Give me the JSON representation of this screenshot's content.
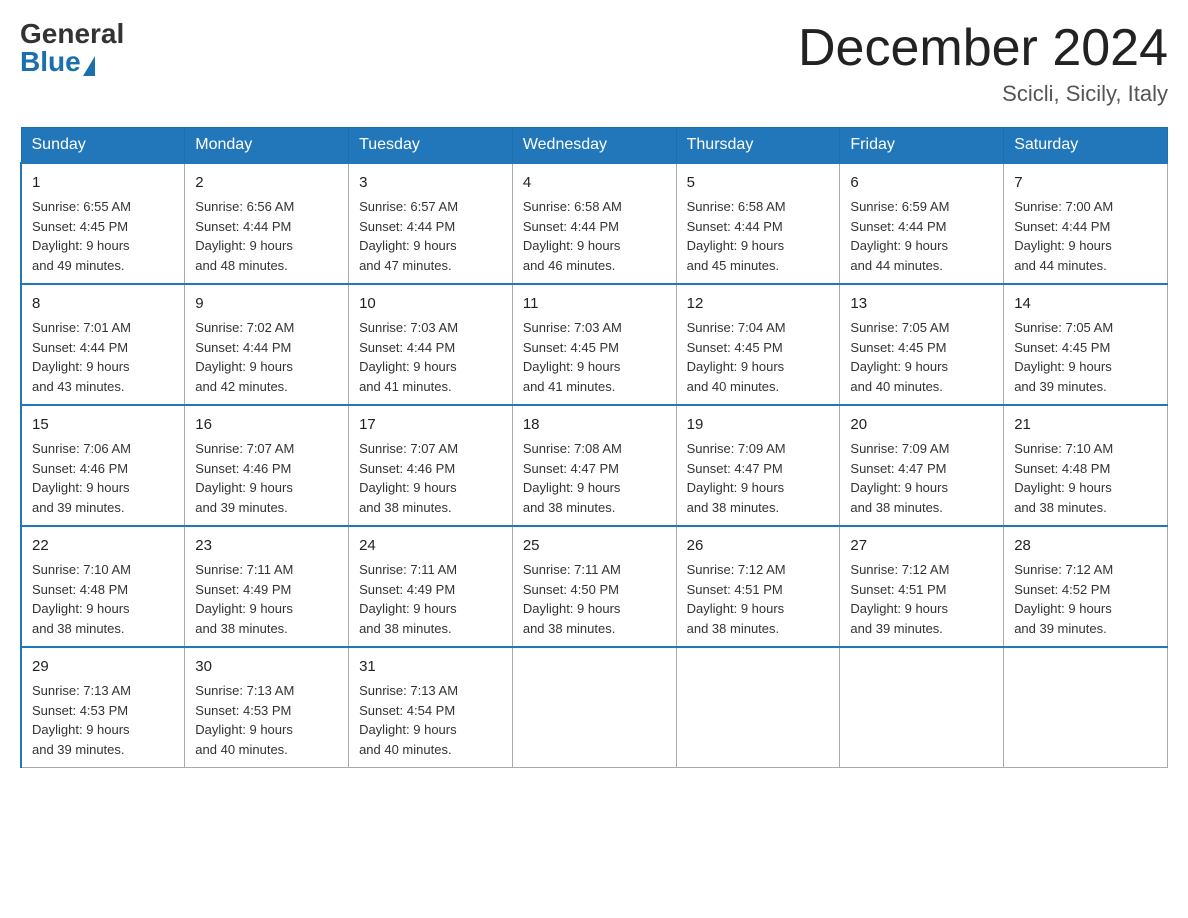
{
  "header": {
    "logo": {
      "general": "General",
      "blue": "Blue"
    },
    "title": "December 2024",
    "location": "Scicli, Sicily, Italy"
  },
  "days_of_week": [
    "Sunday",
    "Monday",
    "Tuesday",
    "Wednesday",
    "Thursday",
    "Friday",
    "Saturday"
  ],
  "weeks": [
    [
      {
        "day": "1",
        "sunrise": "6:55 AM",
        "sunset": "4:45 PM",
        "daylight": "9 hours and 49 minutes."
      },
      {
        "day": "2",
        "sunrise": "6:56 AM",
        "sunset": "4:44 PM",
        "daylight": "9 hours and 48 minutes."
      },
      {
        "day": "3",
        "sunrise": "6:57 AM",
        "sunset": "4:44 PM",
        "daylight": "9 hours and 47 minutes."
      },
      {
        "day": "4",
        "sunrise": "6:58 AM",
        "sunset": "4:44 PM",
        "daylight": "9 hours and 46 minutes."
      },
      {
        "day": "5",
        "sunrise": "6:58 AM",
        "sunset": "4:44 PM",
        "daylight": "9 hours and 45 minutes."
      },
      {
        "day": "6",
        "sunrise": "6:59 AM",
        "sunset": "4:44 PM",
        "daylight": "9 hours and 44 minutes."
      },
      {
        "day": "7",
        "sunrise": "7:00 AM",
        "sunset": "4:44 PM",
        "daylight": "9 hours and 44 minutes."
      }
    ],
    [
      {
        "day": "8",
        "sunrise": "7:01 AM",
        "sunset": "4:44 PM",
        "daylight": "9 hours and 43 minutes."
      },
      {
        "day": "9",
        "sunrise": "7:02 AM",
        "sunset": "4:44 PM",
        "daylight": "9 hours and 42 minutes."
      },
      {
        "day": "10",
        "sunrise": "7:03 AM",
        "sunset": "4:44 PM",
        "daylight": "9 hours and 41 minutes."
      },
      {
        "day": "11",
        "sunrise": "7:03 AM",
        "sunset": "4:45 PM",
        "daylight": "9 hours and 41 minutes."
      },
      {
        "day": "12",
        "sunrise": "7:04 AM",
        "sunset": "4:45 PM",
        "daylight": "9 hours and 40 minutes."
      },
      {
        "day": "13",
        "sunrise": "7:05 AM",
        "sunset": "4:45 PM",
        "daylight": "9 hours and 40 minutes."
      },
      {
        "day": "14",
        "sunrise": "7:05 AM",
        "sunset": "4:45 PM",
        "daylight": "9 hours and 39 minutes."
      }
    ],
    [
      {
        "day": "15",
        "sunrise": "7:06 AM",
        "sunset": "4:46 PM",
        "daylight": "9 hours and 39 minutes."
      },
      {
        "day": "16",
        "sunrise": "7:07 AM",
        "sunset": "4:46 PM",
        "daylight": "9 hours and 39 minutes."
      },
      {
        "day": "17",
        "sunrise": "7:07 AM",
        "sunset": "4:46 PM",
        "daylight": "9 hours and 38 minutes."
      },
      {
        "day": "18",
        "sunrise": "7:08 AM",
        "sunset": "4:47 PM",
        "daylight": "9 hours and 38 minutes."
      },
      {
        "day": "19",
        "sunrise": "7:09 AM",
        "sunset": "4:47 PM",
        "daylight": "9 hours and 38 minutes."
      },
      {
        "day": "20",
        "sunrise": "7:09 AM",
        "sunset": "4:47 PM",
        "daylight": "9 hours and 38 minutes."
      },
      {
        "day": "21",
        "sunrise": "7:10 AM",
        "sunset": "4:48 PM",
        "daylight": "9 hours and 38 minutes."
      }
    ],
    [
      {
        "day": "22",
        "sunrise": "7:10 AM",
        "sunset": "4:48 PM",
        "daylight": "9 hours and 38 minutes."
      },
      {
        "day": "23",
        "sunrise": "7:11 AM",
        "sunset": "4:49 PM",
        "daylight": "9 hours and 38 minutes."
      },
      {
        "day": "24",
        "sunrise": "7:11 AM",
        "sunset": "4:49 PM",
        "daylight": "9 hours and 38 minutes."
      },
      {
        "day": "25",
        "sunrise": "7:11 AM",
        "sunset": "4:50 PM",
        "daylight": "9 hours and 38 minutes."
      },
      {
        "day": "26",
        "sunrise": "7:12 AM",
        "sunset": "4:51 PM",
        "daylight": "9 hours and 38 minutes."
      },
      {
        "day": "27",
        "sunrise": "7:12 AM",
        "sunset": "4:51 PM",
        "daylight": "9 hours and 39 minutes."
      },
      {
        "day": "28",
        "sunrise": "7:12 AM",
        "sunset": "4:52 PM",
        "daylight": "9 hours and 39 minutes."
      }
    ],
    [
      {
        "day": "29",
        "sunrise": "7:13 AM",
        "sunset": "4:53 PM",
        "daylight": "9 hours and 39 minutes."
      },
      {
        "day": "30",
        "sunrise": "7:13 AM",
        "sunset": "4:53 PM",
        "daylight": "9 hours and 40 minutes."
      },
      {
        "day": "31",
        "sunrise": "7:13 AM",
        "sunset": "4:54 PM",
        "daylight": "9 hours and 40 minutes."
      },
      null,
      null,
      null,
      null
    ]
  ]
}
